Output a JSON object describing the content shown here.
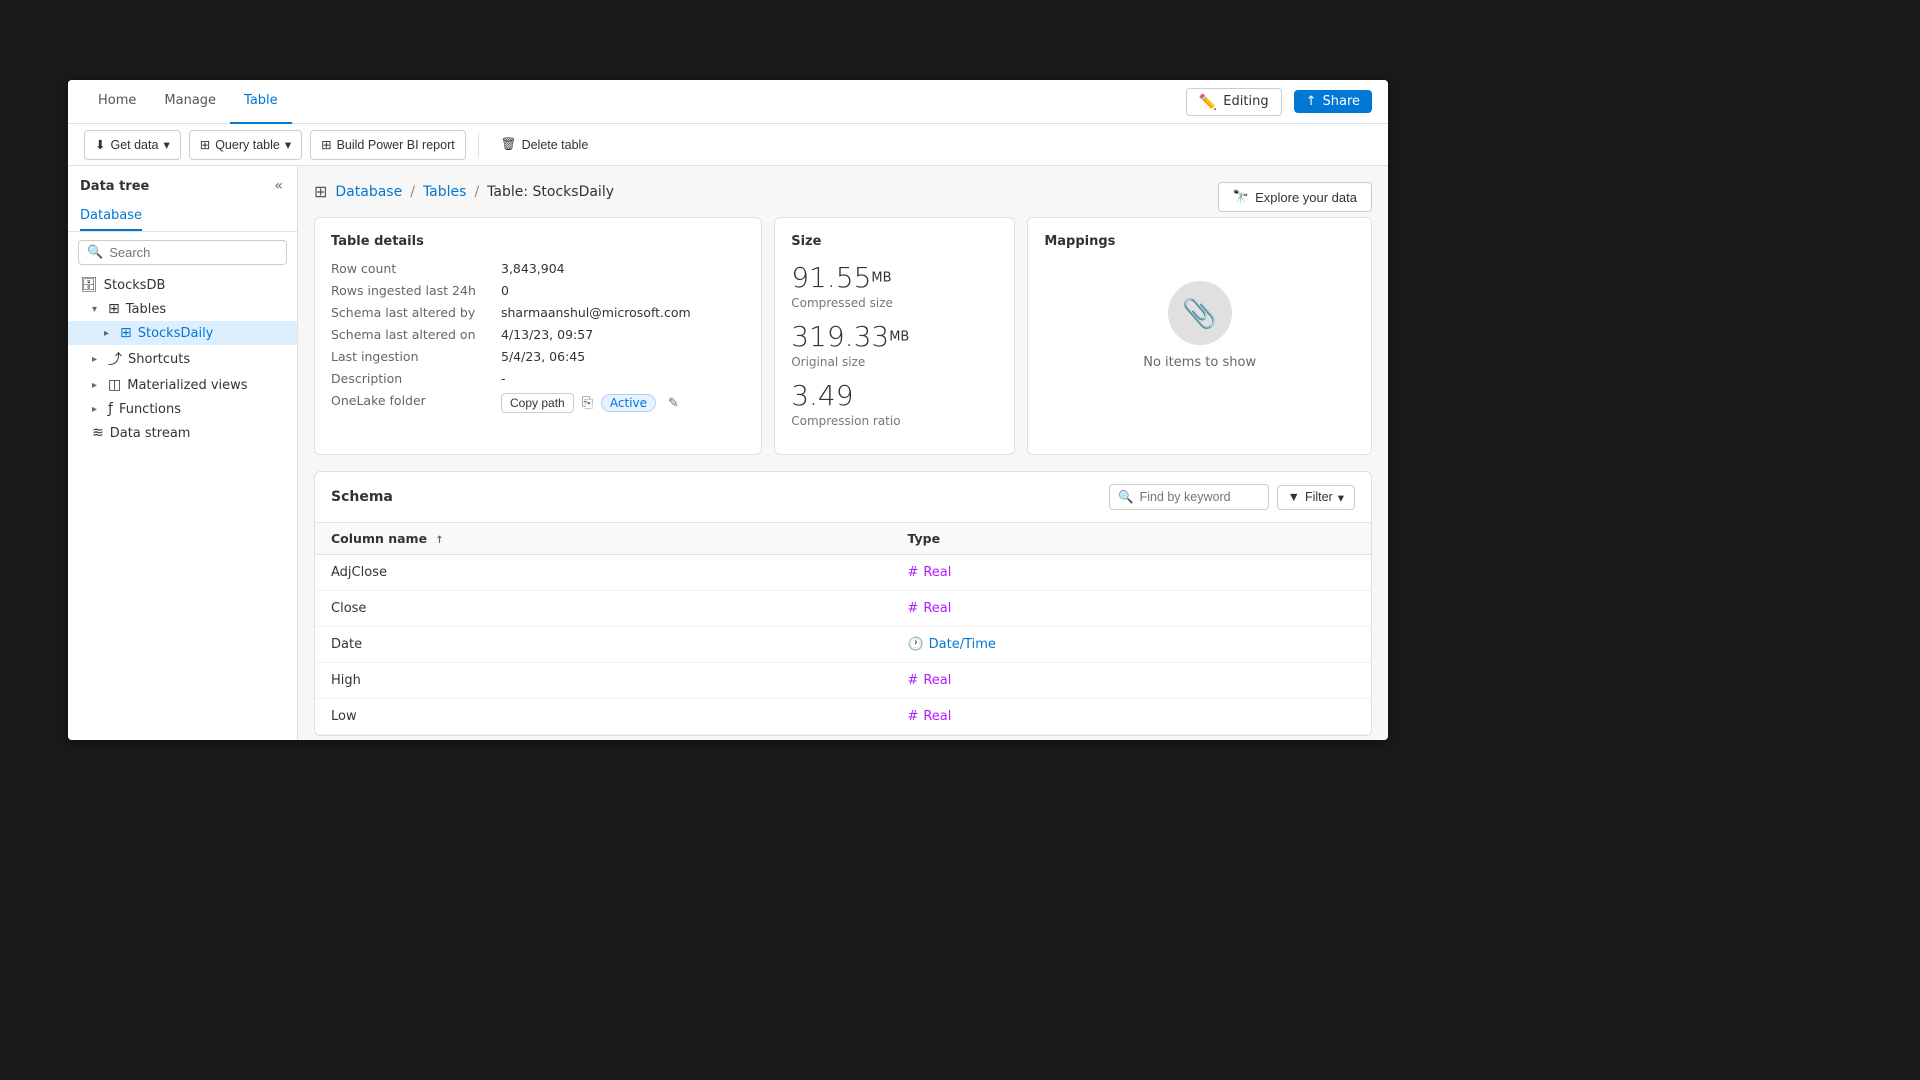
{
  "nav": {
    "tabs": [
      "Home",
      "Manage",
      "Table"
    ],
    "active_tab": "Table",
    "editing_label": "Editing",
    "share_label": "Share"
  },
  "toolbar": {
    "get_data": "Get data",
    "query_table": "Query table",
    "build_power_bi": "Build Power BI report",
    "delete_table": "Delete table"
  },
  "sidebar": {
    "title": "Data tree",
    "active_tab": "Database",
    "search_placeholder": "Search",
    "items": {
      "db_name": "StocksDB",
      "tables_label": "Tables",
      "active_table": "StocksDaily",
      "shortcuts_label": "Shortcuts",
      "materialized_views_label": "Materialized views",
      "functions_label": "Functions",
      "data_stream_label": "Data stream"
    }
  },
  "breadcrumb": {
    "icon": "⊞",
    "parts": [
      "Database",
      "Tables",
      "Table: StocksDaily"
    ]
  },
  "explore_btn": "Explore your data",
  "table_details": {
    "title": "Table details",
    "rows": [
      {
        "label": "Row count",
        "value": "3,843,904"
      },
      {
        "label": "Rows ingested last 24h",
        "value": "0"
      },
      {
        "label": "Schema last altered by",
        "value": "sharmaanshul@microsoft.com"
      },
      {
        "label": "Schema last altered on",
        "value": "4/13/23, 09:57"
      },
      {
        "label": "Last ingestion",
        "value": "5/4/23, 06:45"
      },
      {
        "label": "Description",
        "value": "-"
      }
    ],
    "onelake_label": "OneLake folder",
    "copy_path_label": "Copy path",
    "active_label": "Active"
  },
  "size_card": {
    "title": "Size",
    "compressed_size": "91.55",
    "compressed_unit": "MB",
    "compressed_label": "Compressed size",
    "original_size": "319.33",
    "original_unit": "MB",
    "original_label": "Original size",
    "compression_ratio": "3.49",
    "compression_label": "Compression ratio"
  },
  "mappings_card": {
    "title": "Mappings",
    "empty_text": "No items to show"
  },
  "schema": {
    "title": "Schema",
    "keyword_placeholder": "Find by keyword",
    "filter_label": "Filter",
    "column_header": "Column name",
    "type_header": "Type",
    "columns": [
      {
        "name": "AdjClose",
        "type": "Real",
        "type_kind": "real"
      },
      {
        "name": "Close",
        "type": "Real",
        "type_kind": "real"
      },
      {
        "name": "Date",
        "type": "Date/Time",
        "type_kind": "datetime"
      },
      {
        "name": "High",
        "type": "Real",
        "type_kind": "real"
      },
      {
        "name": "Low",
        "type": "Real",
        "type_kind": "real"
      }
    ]
  }
}
